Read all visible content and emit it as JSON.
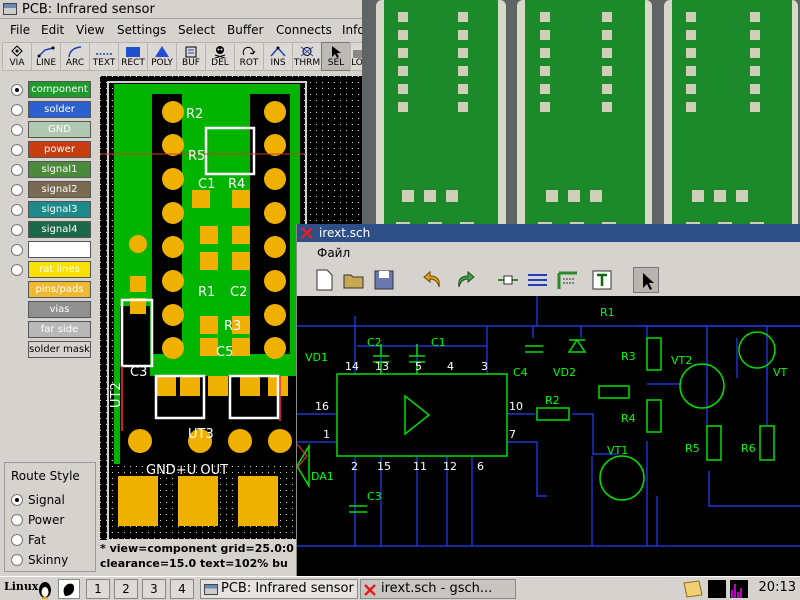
{
  "pcb": {
    "title": "PCB:  Infrared sensor",
    "menu": [
      "File",
      "Edit",
      "View",
      "Settings",
      "Select",
      "Buffer",
      "Connects",
      "Info"
    ],
    "tools": [
      {
        "label": "VIA",
        "icon": "via-icon"
      },
      {
        "label": "LINE",
        "icon": "line-icon"
      },
      {
        "label": "ARC",
        "icon": "arc-icon"
      },
      {
        "label": "TEXT",
        "icon": "text-icon"
      },
      {
        "label": "RECT",
        "icon": "rect-icon"
      },
      {
        "label": "POLY",
        "icon": "poly-icon"
      },
      {
        "label": "BUF",
        "icon": "buffer-icon"
      },
      {
        "label": "DEL",
        "icon": "delete-icon"
      },
      {
        "label": "ROT",
        "icon": "rotate-icon"
      },
      {
        "label": "INS",
        "icon": "insert-icon"
      },
      {
        "label": "THRM",
        "icon": "thermal-icon"
      },
      {
        "label": "SEL",
        "icon": "select-icon"
      },
      {
        "label": "LO",
        "icon": "lock-icon"
      }
    ],
    "layers": [
      {
        "label": "component",
        "color": "#1e9a2a",
        "selected": true
      },
      {
        "label": "solder",
        "color": "#2c5fd0",
        "selected": false
      },
      {
        "label": "GND",
        "color": "#b0c8b0",
        "selected": false
      },
      {
        "label": "power",
        "color": "#c83c10",
        "selected": false
      },
      {
        "label": "signal1",
        "color": "#4a8a3a",
        "selected": false
      },
      {
        "label": "signal2",
        "color": "#7a6a52",
        "selected": false
      },
      {
        "label": "signal3",
        "color": "#1c8a8a",
        "selected": false
      },
      {
        "label": "signal4",
        "color": "#1a6a4a",
        "selected": false
      },
      {
        "label": "",
        "color": "#ffffff",
        "selected": false
      },
      {
        "label": "rat lines",
        "color": "#f8e000",
        "selected": false
      }
    ],
    "extra_layers": [
      {
        "label": "pins/pads",
        "color": "#f0b830"
      },
      {
        "label": "vias",
        "color": "#909090"
      },
      {
        "label": "far side",
        "color": "#b8b8b8"
      },
      {
        "label": "solder mask",
        "color": "#d6d3ce"
      }
    ],
    "route_style": {
      "title": "Route Style",
      "options": [
        "Signal",
        "Power",
        "Fat",
        "Skinny"
      ],
      "selected": "Signal"
    },
    "status": {
      "line1": "*  view=component  grid=25.0:0",
      "line2": "clearance=15.0  text=102%  bu"
    },
    "board_labels": [
      "R2",
      "R5",
      "C1",
      "R4",
      "R1",
      "C2",
      "R3",
      "C5",
      "C3",
      "UT2",
      "UT3",
      "GND+U OUT"
    ]
  },
  "gschem": {
    "title": "irext.sch",
    "menu_first": "Файл",
    "tools": [
      "new-file-icon",
      "open-folder-icon",
      "save-icon",
      "undo-icon",
      "redo-icon",
      "add-component-icon",
      "add-net-icon",
      "add-bus-icon",
      "add-text-icon",
      "select-arrow-icon"
    ],
    "schematic_labels": {
      "refdes": [
        "R1",
        "C2",
        "C1",
        "VD1",
        "C4",
        "VD2",
        "R3",
        "VT2",
        "VT",
        "R4",
        "R2",
        "VT1",
        "R5",
        "R6",
        "DA1",
        "C3"
      ],
      "pins": [
        "14",
        "13",
        "5",
        "4",
        "3",
        "16",
        "10",
        "1",
        "7",
        "2",
        "15",
        "11",
        "12",
        "6"
      ]
    }
  },
  "taskbar": {
    "logo": "Linux",
    "desktops": [
      "1",
      "2",
      "3",
      "4"
    ],
    "tasks": [
      {
        "label": "PCB:  Infrared sensor",
        "active": false
      },
      {
        "label": "irext.sch - gsch...",
        "active": true
      }
    ],
    "clock": "20:13"
  },
  "colors": {
    "board_green": "#00c800",
    "pad_yellow": "#f0b000",
    "schematic_green": "#00e000",
    "net_blue": "#2040ff",
    "outline_red": "#ff3030"
  }
}
